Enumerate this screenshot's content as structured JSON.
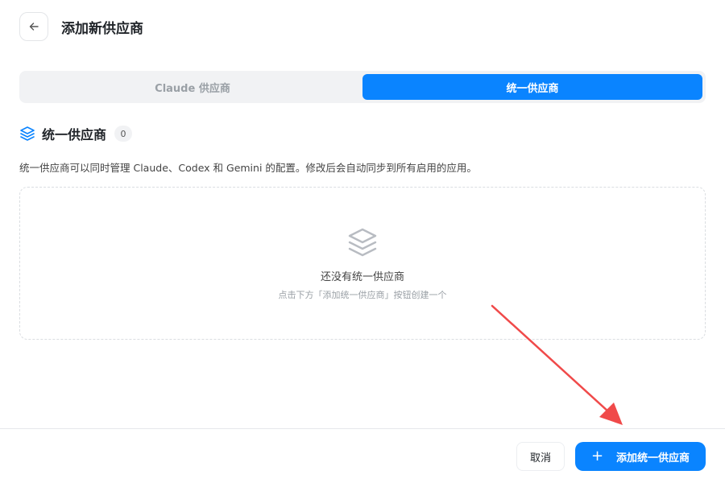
{
  "header": {
    "title": "添加新供应商",
    "back_icon": "arrow-left-icon"
  },
  "tabs": [
    {
      "label": "Claude 供应商",
      "active": false
    },
    {
      "label": "统一供应商",
      "active": true
    }
  ],
  "section": {
    "title": "统一供应商",
    "count": "0",
    "icon": "layers-icon",
    "description": "统一供应商可以同时管理 Claude、Codex 和 Gemini 的配置。修改后会自动同步到所有启用的应用。"
  },
  "empty_state": {
    "icon": "layers-icon",
    "title": "还没有统一供应商",
    "hint": "点击下方「添加统一供应商」按钮创建一个"
  },
  "footer": {
    "cancel_label": "取消",
    "add_label": "添加统一供应商",
    "add_icon": "plus-icon"
  },
  "colors": {
    "accent": "#0a84ff",
    "annotation_arrow": "#f04a4a"
  }
}
